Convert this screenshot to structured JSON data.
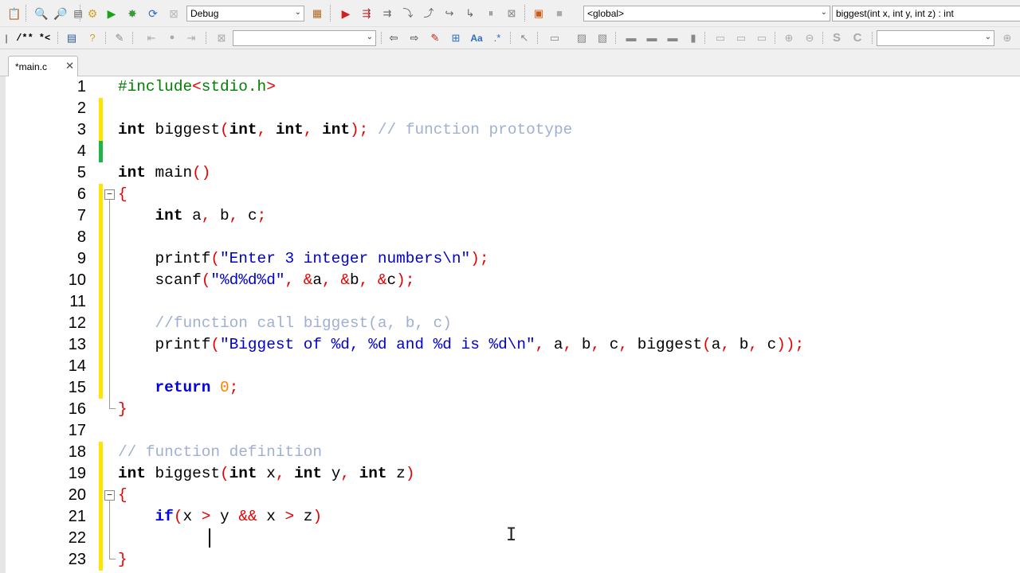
{
  "toolbar_top": {
    "build_config": "Debug",
    "scope": "<global>",
    "symbol": "biggest(int x, int y, int z) : int"
  },
  "toolbar_second": {
    "comment_block": "/**",
    "comment_line": "*<",
    "search_value": "",
    "right_value": ""
  },
  "tabs": [
    {
      "label": "*main.c",
      "close": "✕"
    }
  ],
  "editor": {
    "lines": [
      {
        "num": "1",
        "text": "#include<stdio.h>"
      },
      {
        "num": "2",
        "text": ""
      },
      {
        "num": "3",
        "text": "int biggest(int, int, int); // function prototype"
      },
      {
        "num": "4",
        "text": ""
      },
      {
        "num": "5",
        "text": "int main()"
      },
      {
        "num": "6",
        "text": "{"
      },
      {
        "num": "7",
        "text": "    int a, b, c;"
      },
      {
        "num": "8",
        "text": ""
      },
      {
        "num": "9",
        "text": "    printf(\"Enter 3 integer numbers\\n\");"
      },
      {
        "num": "10",
        "text": "    scanf(\"%d%d%d\", &a, &b, &c);"
      },
      {
        "num": "11",
        "text": ""
      },
      {
        "num": "12",
        "text": "    //function call biggest(a, b, c)"
      },
      {
        "num": "13",
        "text": "    printf(\"Biggest of %d, %d and %d is %d\\n\", a, b, c, biggest(a, b, c));"
      },
      {
        "num": "14",
        "text": ""
      },
      {
        "num": "15",
        "text": "    return 0;"
      },
      {
        "num": "16",
        "text": "}"
      },
      {
        "num": "17",
        "text": ""
      },
      {
        "num": "18",
        "text": "// function definition"
      },
      {
        "num": "19",
        "text": "int biggest(int x, int y, int z)"
      },
      {
        "num": "20",
        "text": "{"
      },
      {
        "num": "21",
        "text": "    if(x > y && x > z)"
      },
      {
        "num": "22",
        "text": "        "
      },
      {
        "num": "23",
        "text": "}"
      }
    ],
    "colors": {
      "keyword": "#000000",
      "preprocessor": "#008000",
      "operator": "#e60000",
      "string": "#0000c8",
      "comment": "#a0b0d0",
      "number": "#ff8000",
      "changed_marker": "#ffe400",
      "saved_marker": "#1fb34a"
    }
  }
}
